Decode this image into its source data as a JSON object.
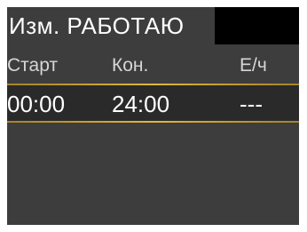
{
  "title": "Изм. РАБОТАЮ",
  "columns": [
    "Старт",
    "Кон.",
    "Е/ч"
  ],
  "rows": [
    {
      "start": "00:00",
      "end": "24:00",
      "rate": "---"
    }
  ],
  "colors": {
    "background": "#3d3d3d",
    "title_bar": "#000000",
    "selection_border": "#e2b63c",
    "text": "#ffffff",
    "header_text": "#d6d6d6"
  }
}
